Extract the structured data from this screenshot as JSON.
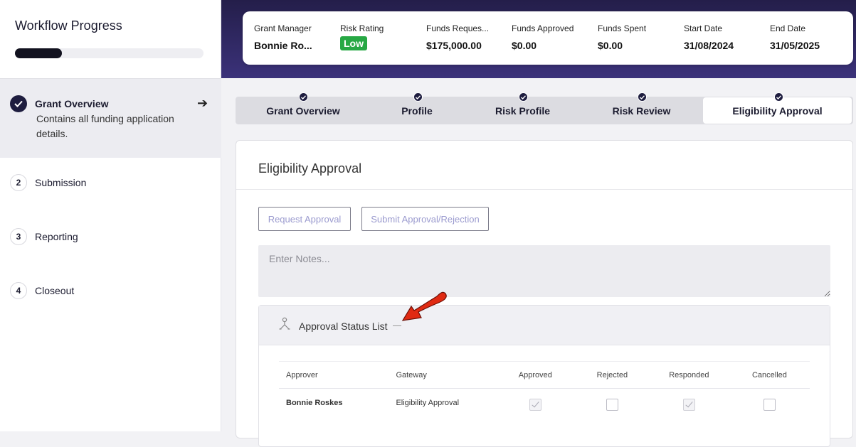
{
  "sidebar": {
    "title": "Workflow Progress",
    "progress": 0.25,
    "active_step": {
      "title": "Grant Overview",
      "description": "Contains all funding application details."
    },
    "steps": [
      {
        "num": "2",
        "label": "Submission"
      },
      {
        "num": "3",
        "label": "Reporting"
      },
      {
        "num": "4",
        "label": "Closeout"
      }
    ]
  },
  "summary": {
    "grant_manager": {
      "label": "Grant Manager",
      "value": "Bonnie Ro..."
    },
    "risk_rating": {
      "label": "Risk Rating",
      "value": "Low"
    },
    "funds_requested": {
      "label": "Funds Reques...",
      "value": "$175,000.00"
    },
    "funds_approved": {
      "label": "Funds Approved",
      "value": "$0.00"
    },
    "funds_spent": {
      "label": "Funds Spent",
      "value": "$0.00"
    },
    "start_date": {
      "label": "Start Date",
      "value": "31/08/2024"
    },
    "end_date": {
      "label": "End Date",
      "value": "31/05/2025"
    }
  },
  "tabs": [
    {
      "label": "Grant Overview"
    },
    {
      "label": "Profile"
    },
    {
      "label": "Risk Profile"
    },
    {
      "label": "Risk Review"
    },
    {
      "label": "Eligibility Approval"
    }
  ],
  "panel": {
    "title": "Eligibility Approval",
    "request_button": "Request Approval",
    "submit_button": "Submit Approval/Rejection",
    "notes_placeholder": "Enter Notes...",
    "status_title": "Approval Status List",
    "columns": [
      "Approver",
      "Gateway",
      "Approved",
      "Rejected",
      "Responded",
      "Cancelled"
    ],
    "rows": [
      {
        "approver": "Bonnie Roskes",
        "gateway": "Eligibility Approval",
        "approved": true,
        "rejected": false,
        "responded": true,
        "cancelled": false
      }
    ]
  },
  "colors": {
    "header_gradient_top": "#241e4a",
    "header_gradient_bottom": "#3b327a",
    "badge_low": "#27a844",
    "annotation_arrow": "#e02a12"
  }
}
